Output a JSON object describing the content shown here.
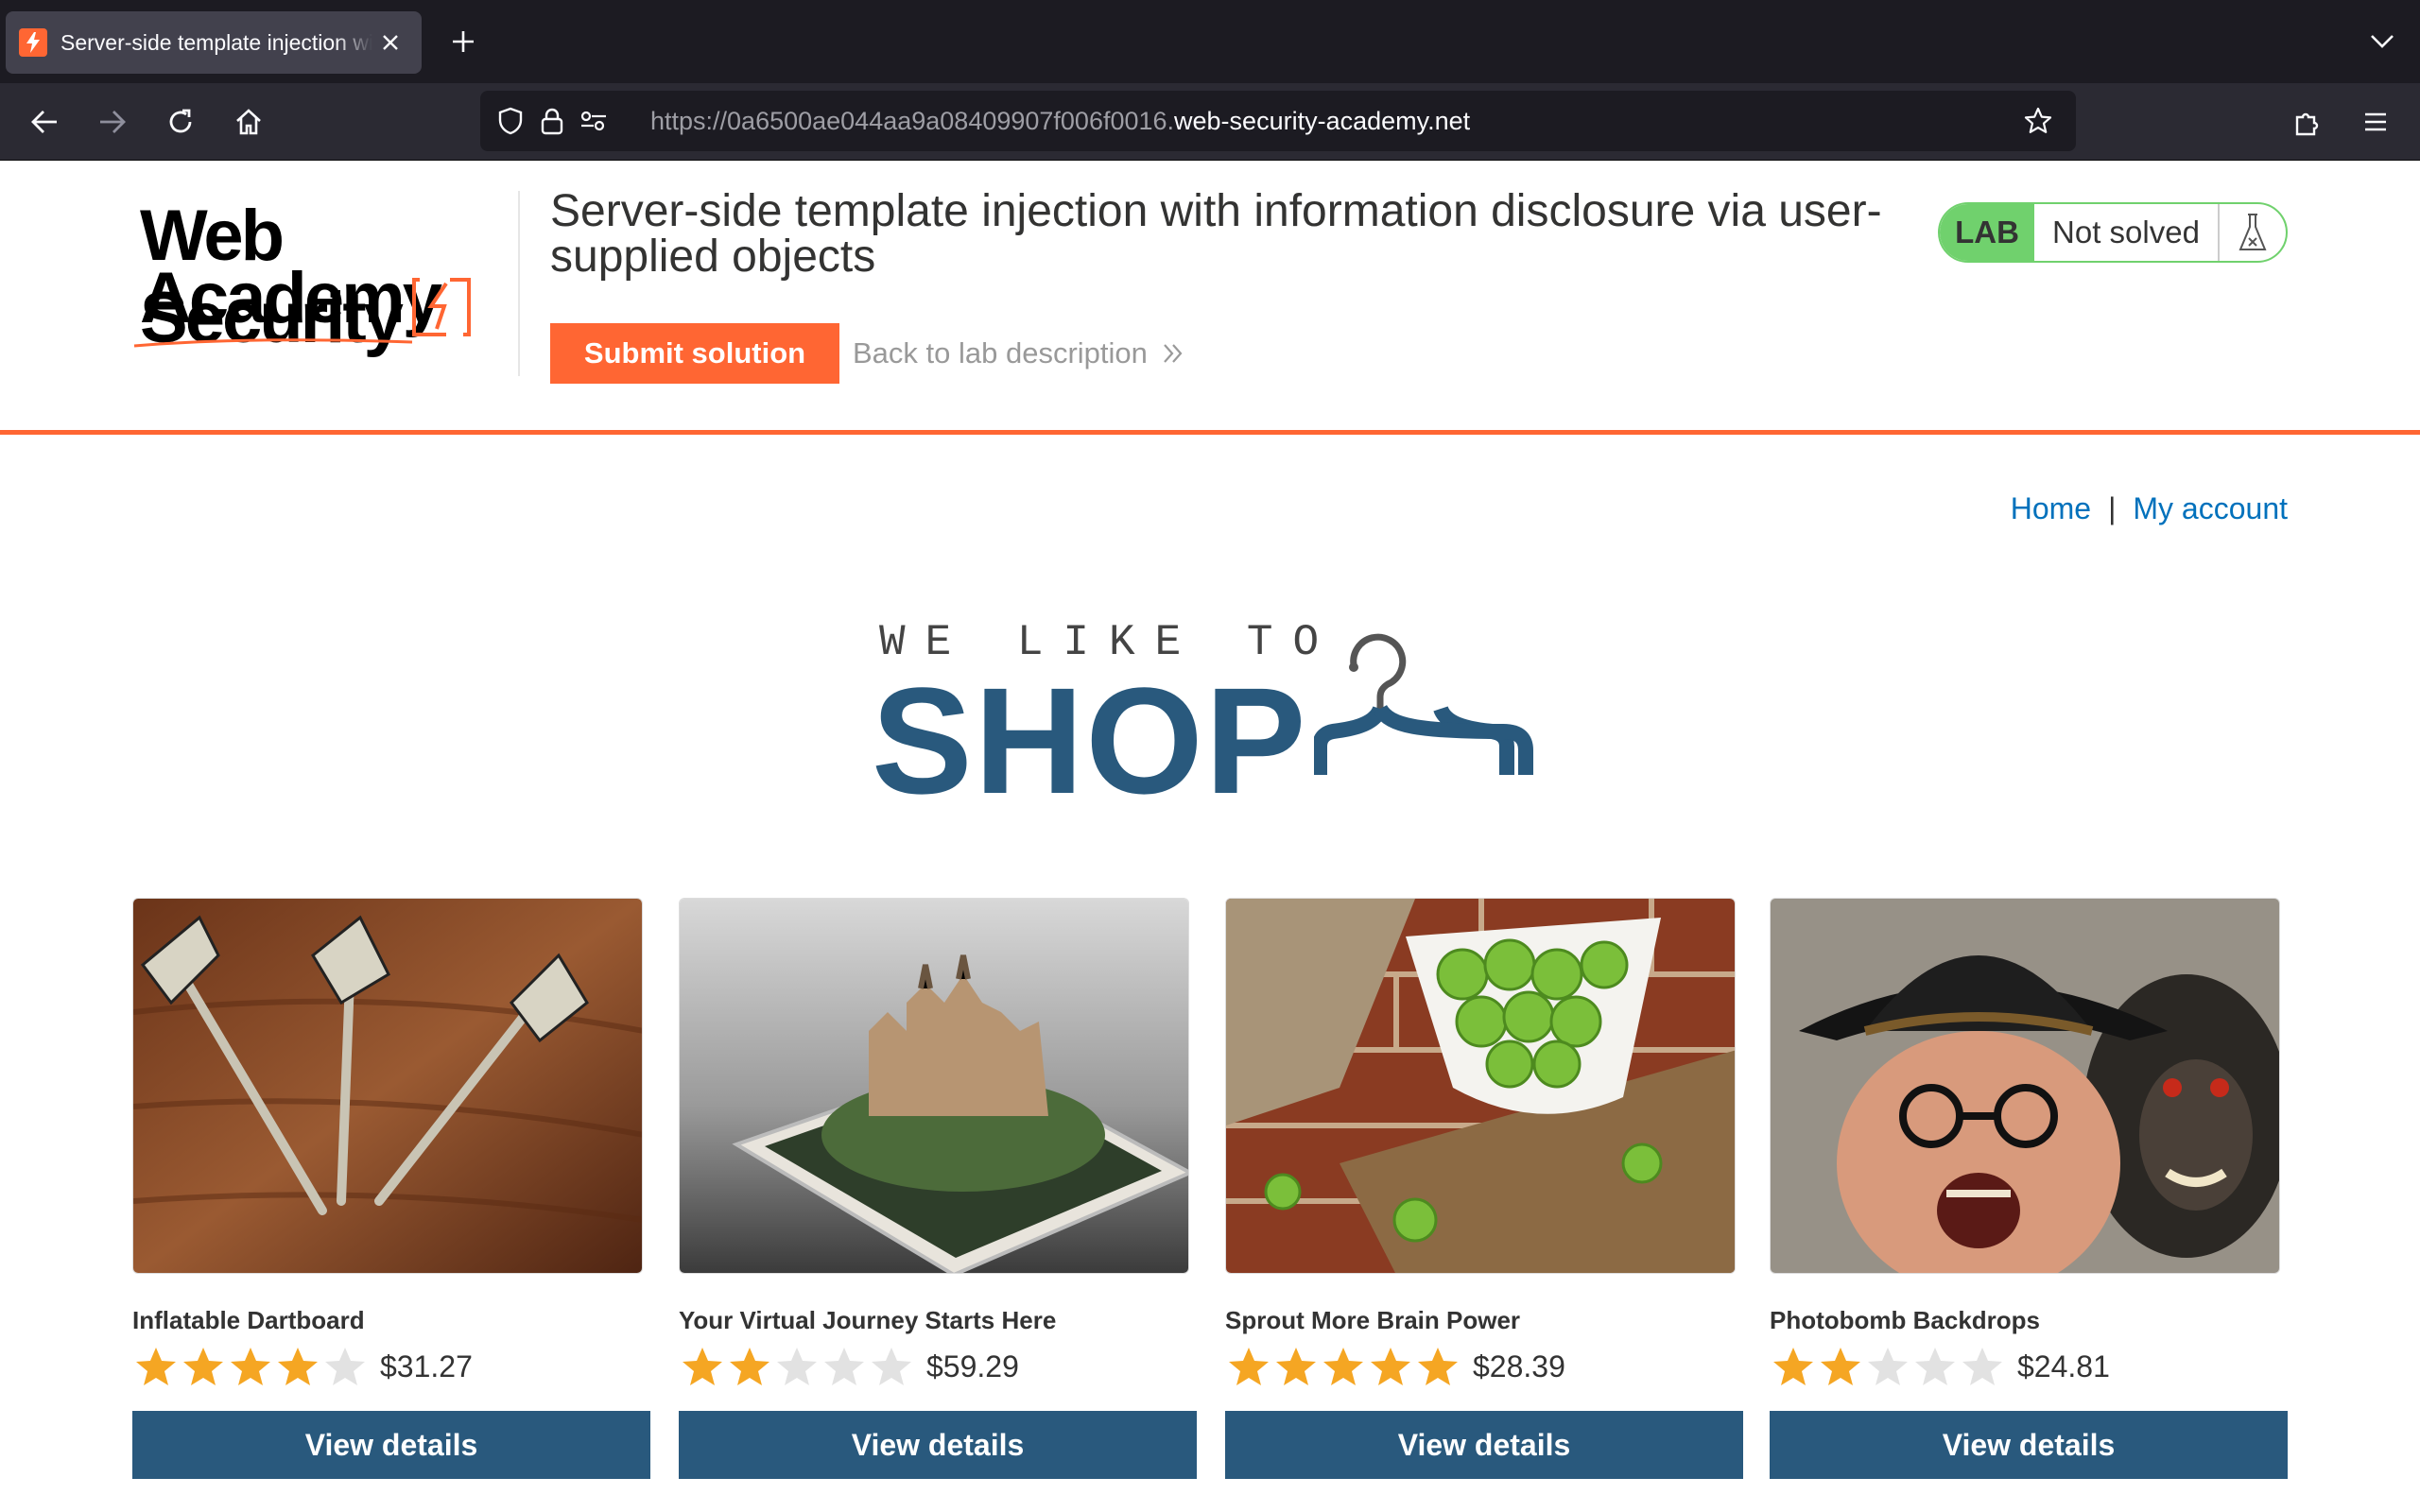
{
  "browser": {
    "tab_title": "Server-side template injection with information disclosure via user-supplied objects",
    "url_prefix": "https://0a6500ae044aa9a08409907f006f0016.",
    "url_host": "web-security-academy.net"
  },
  "lab_header": {
    "logo_line1": "Web Security",
    "logo_line2": "Academy",
    "title": "Server-side template injection with information disclosure via user-supplied objects",
    "submit_label": "Submit solution",
    "back_label": "Back to lab description",
    "badge": "LAB",
    "status": "Not solved",
    "colors": {
      "accent": "#ff6633",
      "solved_green": "#70d16d"
    }
  },
  "nav": {
    "home": "Home",
    "separator": "|",
    "account": "My account"
  },
  "banner": {
    "tagline": "WE LIKE TO",
    "shop": "SHOP"
  },
  "products": [
    {
      "name": "Inflatable Dartboard",
      "rating": 4,
      "price": "$31.27",
      "button": "View details",
      "image": "darts"
    },
    {
      "name": "Your Virtual Journey Starts Here",
      "rating": 2,
      "price": "$59.29",
      "button": "View details",
      "image": "castle-phone"
    },
    {
      "name": "Sprout More Brain Power",
      "rating": 5,
      "price": "$28.39",
      "button": "View details",
      "image": "sprouts"
    },
    {
      "name": "Photobomb Backdrops",
      "rating": 2,
      "price": "$24.81",
      "button": "View details",
      "image": "man-monkey"
    }
  ],
  "colors": {
    "brand_blue": "#29597d",
    "link_blue": "#0071bc",
    "star_on": "#f5a623",
    "star_off": "#e2e2e2"
  }
}
